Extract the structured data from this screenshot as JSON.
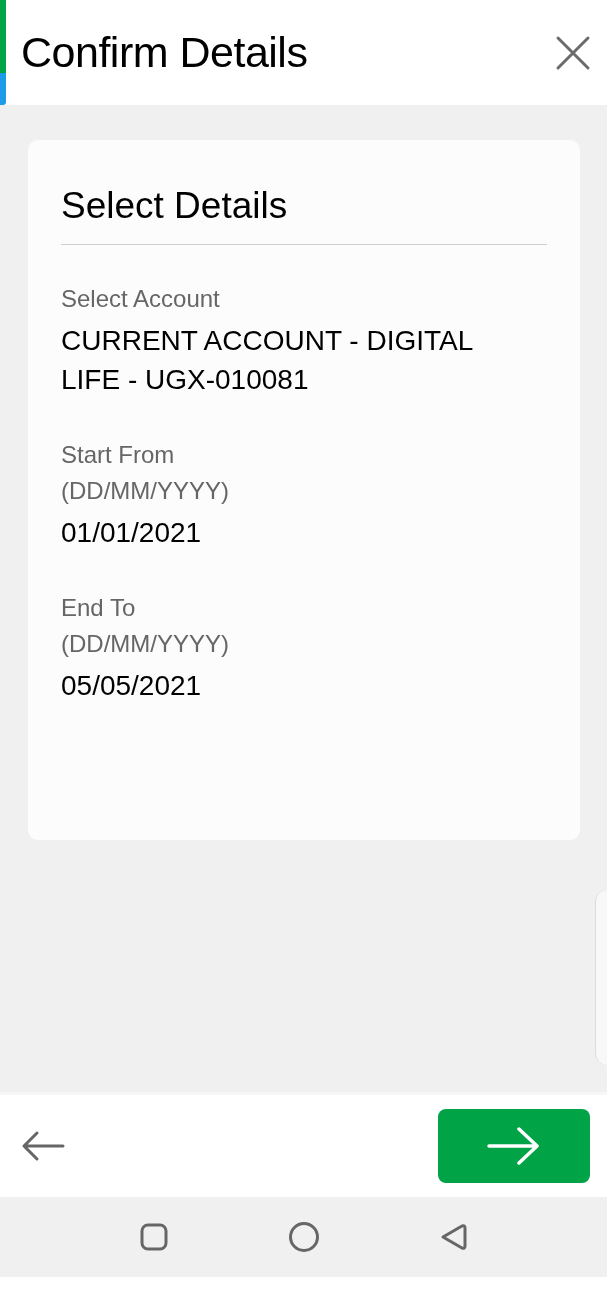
{
  "header": {
    "title": "Confirm Details"
  },
  "card": {
    "title": "Select Details",
    "fields": [
      {
        "label": "Select Account",
        "value": "CURRENT ACCOUNT - DIGITAL LIFE - UGX-010081"
      },
      {
        "label": "Start From",
        "format": "(DD/MM/YYYY)",
        "value": "01/01/2021"
      },
      {
        "label": "End To",
        "format": "(DD/MM/YYYY)",
        "value": "05/05/2021"
      }
    ]
  }
}
